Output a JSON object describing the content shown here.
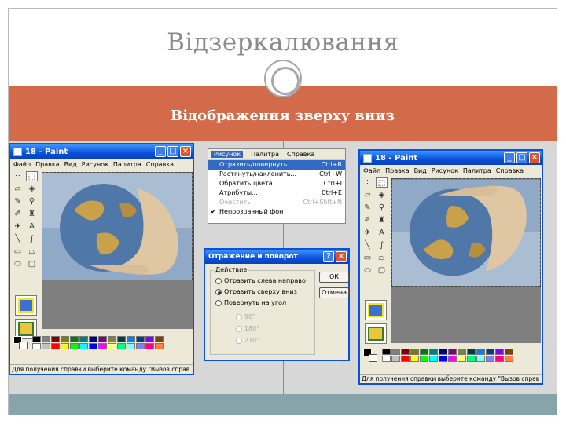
{
  "slide": {
    "title": "Відзеркалювання",
    "subtitle": "Відображення зверху вниз",
    "band_color": "#d36b4b",
    "bottom_bar_color": "#86a4aa"
  },
  "paint_left": {
    "title": "18 - Paint",
    "menu": [
      "Файл",
      "Правка",
      "Вид",
      "Рисунок",
      "Палитра",
      "Справка"
    ],
    "status": "Для получения справки выберите команду \"Вызов справ"
  },
  "paint_right": {
    "title": "18 - Paint",
    "menu": [
      "Файл",
      "Правка",
      "Вид",
      "Рисунок",
      "Палитра",
      "Справка"
    ],
    "status": "Для получения справки выберите команду \"Вызов справ"
  },
  "image_menu": {
    "bar": [
      "Рисунок",
      "Палитра",
      "Справка"
    ],
    "items": [
      {
        "label": "Отразить/повернуть...",
        "shortcut": "Ctrl+R",
        "highlighted": true
      },
      {
        "label": "Растянуть/наклонить...",
        "shortcut": "Ctrl+W"
      },
      {
        "label": "Обратить цвета",
        "shortcut": "Ctrl+I"
      },
      {
        "label": "Атрибуты...",
        "shortcut": "Ctrl+E"
      },
      {
        "label": "Очистить",
        "shortcut": "Ctrl+Shft+N",
        "disabled": true
      },
      {
        "label": "Непрозрачный фон",
        "shortcut": "",
        "checked": true
      }
    ]
  },
  "flip_dialog": {
    "title": "Отражение и поворот",
    "group_label": "Действие",
    "options": [
      {
        "label": "Отразить слева направо",
        "selected": false
      },
      {
        "label": "Отразить сверху вниз",
        "selected": true
      },
      {
        "label": "Повернуть на угол",
        "selected": false
      }
    ],
    "angles": [
      "90°",
      "180°",
      "270°"
    ],
    "ok_label": "ОК",
    "cancel_label": "Отмена"
  },
  "palette_colors": [
    "#000000",
    "#808080",
    "#800000",
    "#808000",
    "#008000",
    "#008080",
    "#000080",
    "#800080",
    "#808040",
    "#004040",
    "#0080ff",
    "#004080",
    "#8000ff",
    "#804000",
    "#ffffff",
    "#c0c0c0",
    "#ff0000",
    "#ffff00",
    "#00ff00",
    "#00ffff",
    "#0000ff",
    "#ff00ff",
    "#ffff80",
    "#00ff80",
    "#80ffff",
    "#8080ff",
    "#ff0080",
    "#ff8040"
  ]
}
